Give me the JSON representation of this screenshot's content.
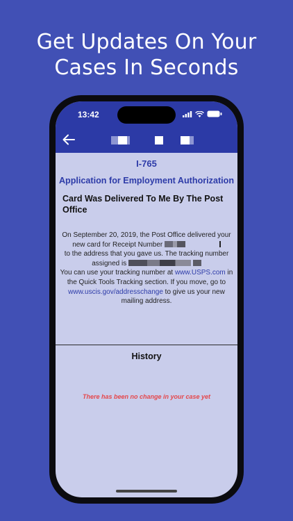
{
  "promo": {
    "line1": "Get Updates On Your",
    "line2": "Cases In Seconds"
  },
  "status_bar": {
    "time": "13:42"
  },
  "nav": {
    "back_icon": "arrow-left-icon"
  },
  "case": {
    "form_type": "I-765",
    "application_name": "Application for Employment Authorization",
    "status_title": "Card Was Delivered To Me By The Post Office",
    "desc": {
      "p1": "On September 20, 2019, the Post Office delivered your new card for Receipt Number",
      "p2": "to the address that you gave us. The tracking number assigned is",
      "p3": "You can use your tracking number at",
      "link_usps": "www.USPS.com",
      "p4": "in the Quick Tools Tracking section. If you move, go to",
      "link_address": "www.uscis.gov/addresschange",
      "p5": "to give us your new mailing address."
    }
  },
  "history": {
    "title": "History",
    "empty_message": "There has been no change in your case yet"
  },
  "colors": {
    "background": "#4150b5",
    "header": "#2c3aa6",
    "screen_bg": "#c9cdeb",
    "accent": "#2d3ba8",
    "empty_message": "#e5474b"
  }
}
